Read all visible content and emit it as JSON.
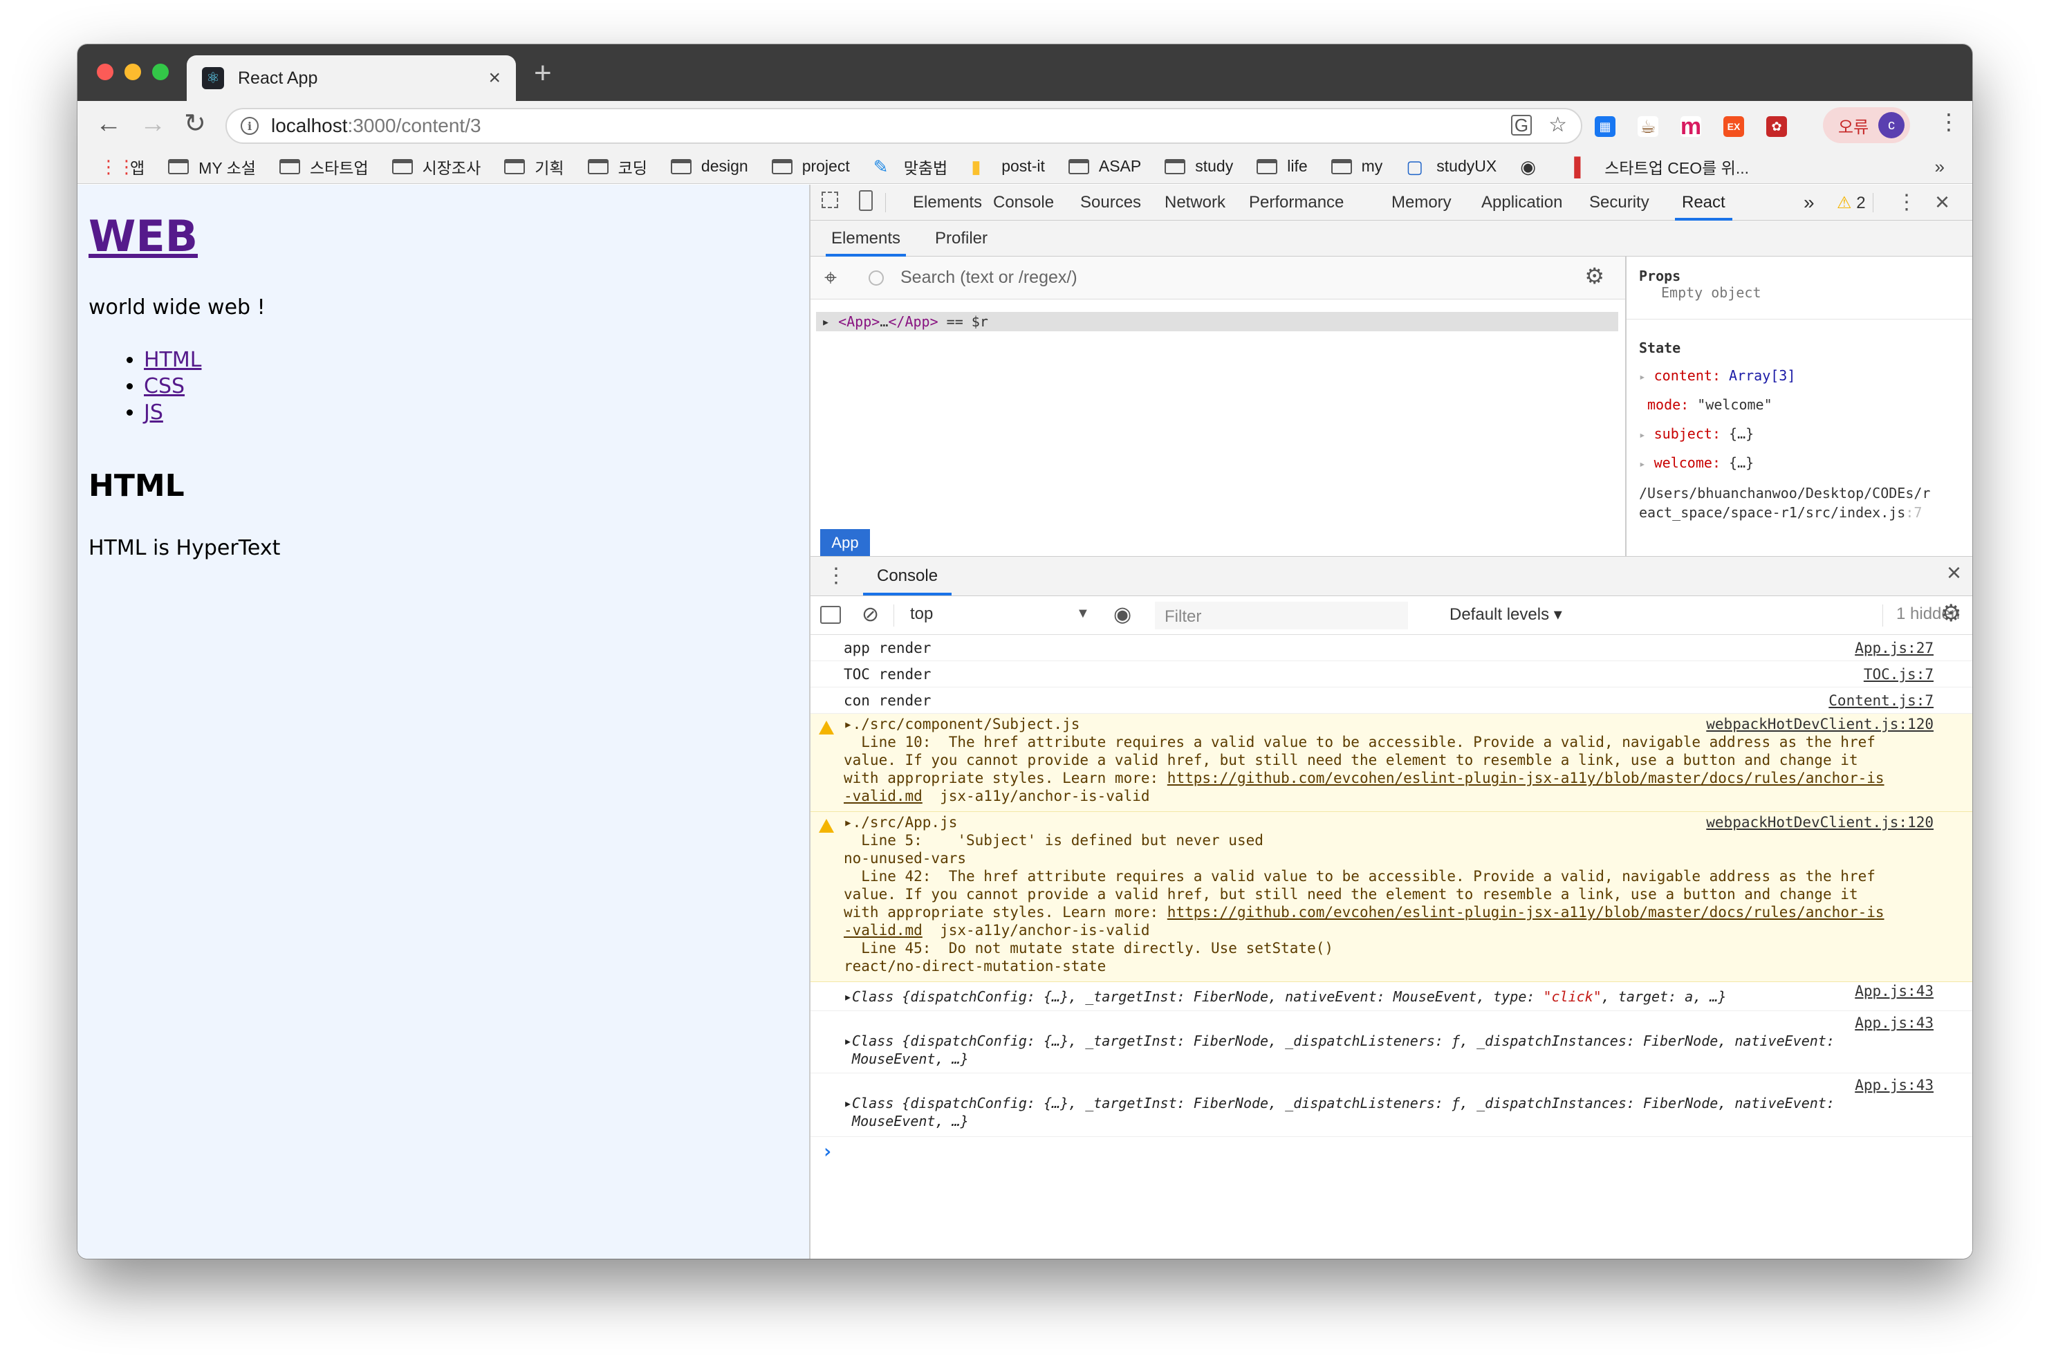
{
  "browser": {
    "tab_title": "React App",
    "url_host": "localhost",
    "url_rest": ":3000/content/3",
    "error_label": "오류",
    "avatar_letter": "c"
  },
  "bookmarks": [
    {
      "label": "앱",
      "icon": "apps-grid-icon"
    },
    {
      "label": "MY 소설",
      "icon": "folder-icon"
    },
    {
      "label": "스타트업",
      "icon": "folder-icon"
    },
    {
      "label": "시장조사",
      "icon": "folder-icon"
    },
    {
      "label": "기획",
      "icon": "folder-icon"
    },
    {
      "label": "코딩",
      "icon": "folder-icon"
    },
    {
      "label": "design",
      "icon": "folder-icon"
    },
    {
      "label": "project",
      "icon": "folder-icon"
    },
    {
      "label": "맞춤법",
      "icon": "spell-icon"
    },
    {
      "label": "post-it",
      "icon": "postit-icon"
    },
    {
      "label": "ASAP",
      "icon": "folder-icon"
    },
    {
      "label": "study",
      "icon": "folder-icon"
    },
    {
      "label": "life",
      "icon": "folder-icon"
    },
    {
      "label": "my",
      "icon": "folder-icon"
    },
    {
      "label": "studyUX",
      "icon": "studyux-icon"
    },
    {
      "label": "",
      "icon": "globe-icon"
    },
    {
      "label": "스타트업 CEO를 위...",
      "icon": "bookmark-red-icon"
    }
  ],
  "bookmarks_more": "»",
  "page": {
    "title": "WEB",
    "subtitle": "world wide web !",
    "links": [
      "HTML",
      "CSS",
      "JS"
    ],
    "heading": "HTML",
    "desc": "HTML is HyperText"
  },
  "devtools": {
    "tabs": [
      "Elements",
      "Console",
      "Sources",
      "Network",
      "Performance",
      "Memory",
      "Application",
      "Security",
      "React"
    ],
    "active_tab": "React",
    "more": "»",
    "warning_count": "2",
    "react_subtabs": [
      "Elements",
      "Profiler"
    ],
    "search_placeholder": "Search (text or /regex/)",
    "tree_row": {
      "open": "<App>",
      "ellipsis": "…",
      "close": "</App>",
      "suffix": " == $r"
    },
    "selected_badge": "App",
    "props": {
      "props_header": "Props",
      "props_empty": "Empty object",
      "state_header": "State",
      "state": [
        {
          "key": "content",
          "value": "Array[3]",
          "expandable": true
        },
        {
          "key": "mode",
          "value": "\"welcome\"",
          "expandable": false
        },
        {
          "key": "subject",
          "value": "{…}",
          "expandable": true
        },
        {
          "key": "welcome",
          "value": "{…}",
          "expandable": true
        }
      ],
      "source_line1": "/Users/bhuanchanwoo/Desktop/CODEs/r",
      "source_line2": "eact_space/space-r1/src/index.js",
      "source_line_no": ":7"
    },
    "drawer_tab": "Console",
    "console": {
      "context": "top",
      "filter_placeholder": "Filter",
      "levels": "Default levels ▾",
      "hidden": "1 hidden",
      "logs": [
        {
          "msg": "app render",
          "src": "App.js:27"
        },
        {
          "msg": "TOC render",
          "src": "TOC.js:7"
        },
        {
          "msg": "con render",
          "src": "Content.js:7"
        }
      ],
      "warn1": {
        "src": "webpackHotDevClient.js:120",
        "l1": "▸./src/component/Subject.js",
        "l2": "  Line 10:  The href attribute requires a valid value to be accessible. Provide a valid, navigable address as the href",
        "l3": "value. If you cannot provide a valid href, but still need the element to resemble a link, use a button and change it",
        "l4": "with appropriate styles. Learn more: ",
        "link_a": "https://github.com/evcohen/eslint-plugin-jsx-a11y/blob/master/docs/rules/anchor-is",
        "link_b": "-valid.md",
        "l5": "  jsx-a11y/anchor-is-valid"
      },
      "warn2": {
        "src": "webpackHotDevClient.js:120",
        "l1": "▸./src/App.js",
        "l2": "  Line 5:    'Subject' is defined but never used",
        "l3": "no-unused-vars",
        "l4": "  Line 42:  The href attribute requires a valid value to be accessible. Provide a valid, navigable address as the href",
        "l5": "value. If you cannot provide a valid href, but still need the element to resemble a link, use a button and change it",
        "l6": "with appropriate styles. Learn more: ",
        "link_a": "https://github.com/evcohen/eslint-plugin-jsx-a11y/blob/master/docs/rules/anchor-is",
        "link_b": "-valid.md",
        "l7": "  jsx-a11y/anchor-is-valid",
        "l8": "  Line 45:  Do not mutate state directly. Use setState()",
        "l9": "react/no-direct-mutation-state"
      },
      "obj1": {
        "pre": "▸Class {dispatchConfig: {…}, _targetInst: FiberNode, nativeEvent: MouseEvent, type: ",
        "str": "\"click\"",
        "post": ", target: a, …}",
        "src": "App.js:43"
      },
      "obj2": {
        "l1": "▸Class {dispatchConfig: {…}, _targetInst: FiberNode, _dispatchListeners: ƒ, _dispatchInstances: FiberNode, nativeEvent:",
        "l2": " MouseEvent, …}",
        "src": "App.js:43"
      },
      "obj3": {
        "l1": "▸Class {dispatchConfig: {…}, _targetInst: FiberNode, _dispatchListeners: ƒ, _dispatchInstances: FiberNode, nativeEvent:",
        "l2": " MouseEvent, …}",
        "src": "App.js:43"
      },
      "prompt": "›"
    }
  },
  "colors": {
    "accent": "#1a73e8",
    "link": "#551a8b",
    "warn_bg": "#fffbe5",
    "react_bg": "#eff5fe"
  }
}
